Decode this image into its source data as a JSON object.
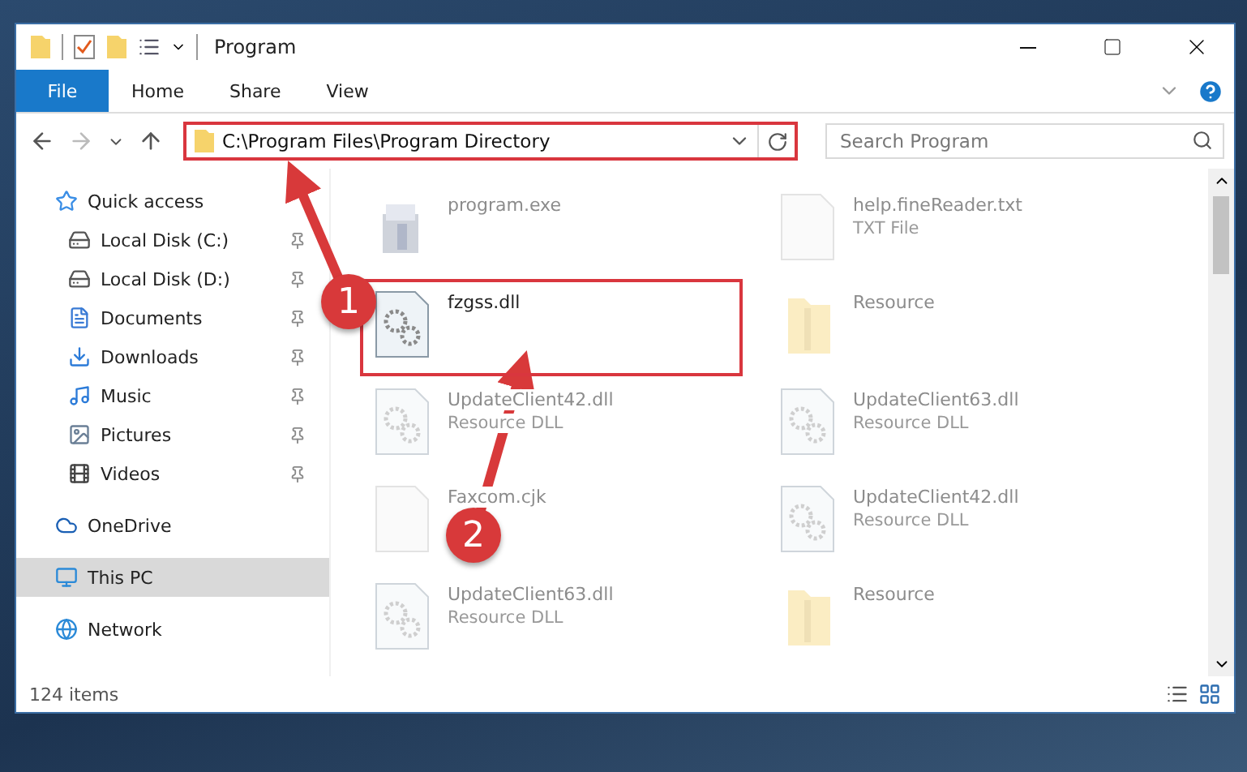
{
  "window": {
    "title": "Program"
  },
  "ribbon_tabs": [
    {
      "label": "File",
      "selected": true
    },
    {
      "label": "Home",
      "selected": false
    },
    {
      "label": "Share",
      "selected": false
    },
    {
      "label": "View",
      "selected": false
    }
  ],
  "address_bar": {
    "path": "C:\\Program Files\\Program Directory",
    "marked": true
  },
  "search": {
    "placeholder": "Search Program"
  },
  "sidebar": {
    "items": [
      {
        "label": "Quick access",
        "kind": "star",
        "selected": false,
        "children": [
          {
            "label": "Local Disk (C:)",
            "kind": "drive",
            "selected": false,
            "pinned": true
          },
          {
            "label": "Local Disk (D:)",
            "kind": "drive",
            "selected": false,
            "pinned": true
          },
          {
            "label": "Documents",
            "kind": "documents",
            "selected": false,
            "pinned": true
          },
          {
            "label": "Downloads",
            "kind": "downloads",
            "selected": false,
            "pinned": true
          },
          {
            "label": "Music",
            "kind": "music",
            "selected": false,
            "pinned": true
          },
          {
            "label": "Pictures",
            "kind": "pictures",
            "selected": false,
            "pinned": true
          },
          {
            "label": "Videos",
            "kind": "videos",
            "selected": false,
            "pinned": true
          }
        ]
      },
      {
        "label": "OneDrive",
        "kind": "cloud",
        "selected": false
      },
      {
        "label": "This PC",
        "kind": "pc",
        "selected": true
      },
      {
        "label": "Network",
        "kind": "network",
        "selected": false
      }
    ]
  },
  "files": [
    {
      "name": "program.exe",
      "kind": "exe",
      "faded": true,
      "marked": false
    },
    {
      "name": "help.fineReader.txt",
      "type": "TXT File",
      "kind": "txt",
      "faded": true,
      "marked": false
    },
    {
      "name": "fzgss.dll",
      "kind": "dll",
      "faded": false,
      "marked": true
    },
    {
      "name": "Resource",
      "kind": "folder",
      "faded": true,
      "marked": false
    },
    {
      "name": "UpdateClient42.dll",
      "type": "Resource DLL",
      "kind": "dll",
      "faded": true,
      "marked": false
    },
    {
      "name": "UpdateClient63.dll",
      "type": "Resource DLL",
      "kind": "dll",
      "faded": true,
      "marked": false
    },
    {
      "name": "Faxcom.cjk",
      "kind": "txt",
      "faded": true,
      "marked": false
    },
    {
      "name": "UpdateClient42.dll",
      "type": "Resource DLL",
      "kind": "dll",
      "faded": true,
      "marked": false
    },
    {
      "name": "UpdateClient63.dll",
      "type": "Resource DLL",
      "kind": "dll",
      "faded": true,
      "marked": false
    },
    {
      "name": "Resource",
      "kind": "folder",
      "faded": true,
      "marked": false
    }
  ],
  "status_bar": {
    "count": "124 items"
  },
  "annotations": [
    {
      "number": "1"
    },
    {
      "number": "2"
    }
  ]
}
